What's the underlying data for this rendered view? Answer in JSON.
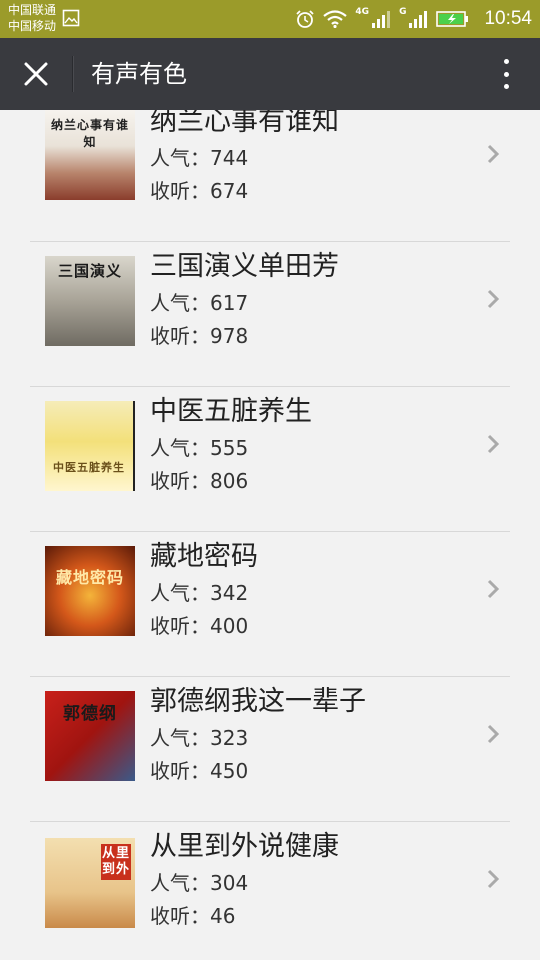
{
  "status_bar": {
    "carrier_1": "中国联通",
    "carrier_2": "中国移动",
    "net_1": "4G",
    "net_2": "G",
    "time": "10:54"
  },
  "app_bar": {
    "title": "有声有色"
  },
  "list": {
    "popularity_label": "人气：",
    "listens_label": "收听：",
    "items": [
      {
        "title": "纳兰心事有谁知",
        "popularity": "744",
        "listens": "674",
        "cover_text": "纳兰心事有谁知"
      },
      {
        "title": "三国演义单田芳",
        "popularity": "617",
        "listens": "978",
        "cover_text": "三国演义"
      },
      {
        "title": "中医五脏养生",
        "popularity": "555",
        "listens": "806",
        "cover_text": "中医五脏养生"
      },
      {
        "title": "藏地密码",
        "popularity": "342",
        "listens": "400",
        "cover_text": "藏地密码"
      },
      {
        "title": "郭德纲我这一辈子",
        "popularity": "323",
        "listens": "450",
        "cover_text": "郭德纲"
      },
      {
        "title": "从里到外说健康",
        "popularity": "304",
        "listens": "46",
        "cover_text": "从里到外"
      }
    ]
  },
  "colors": {
    "status_bar": "#9b9b2a",
    "app_bar": "#393a3f",
    "background": "#f2f2f2"
  }
}
